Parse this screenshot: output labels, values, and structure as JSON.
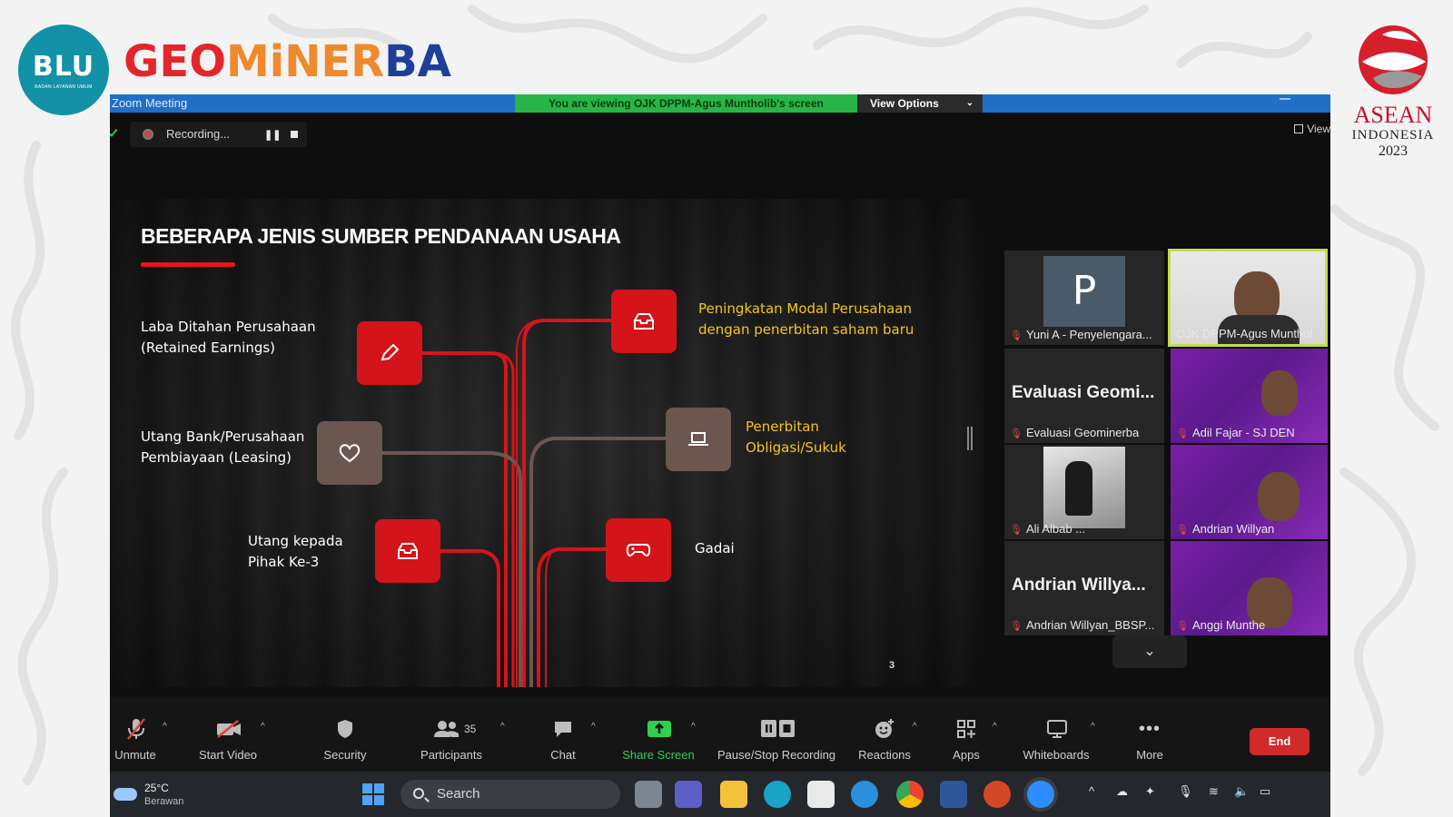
{
  "branding": {
    "blu_logo_text": "BLU",
    "blu_logo_sub": "BADAN LAYANAN UMUM",
    "title_part1": "GEO",
    "title_part2": "MiNER",
    "title_part3": "BA",
    "asean_line1": "ASEAN",
    "asean_line2": "INDONESIA",
    "asean_line3": "2023"
  },
  "zoom": {
    "window_title": "Zoom Meeting",
    "share_banner": "You are viewing OJK DPPM-Agus Muntholib's screen",
    "view_options": "View Options",
    "recording_label": "Recording...",
    "view_label": "View"
  },
  "slide": {
    "title": "BEBERAPA JENIS SUMBER PENDANAAN USAHA",
    "items": [
      {
        "line1": "Laba Ditahan Perusahaan",
        "line2": "(Retained Earnings)"
      },
      {
        "line1": "Utang Bank/Perusahaan",
        "line2": "Pembiayaan (Leasing)"
      },
      {
        "line1": "Utang kepada",
        "line2": "Pihak Ke-3"
      },
      {
        "line1": "Peningkatan Modal Perusahaan",
        "line2": "dengan penerbitan saham baru"
      },
      {
        "line1": "Penerbitan",
        "line2": "Obligasi/Sukuk"
      },
      {
        "line1": "Gadai",
        "line2": ""
      }
    ],
    "page_number": "3",
    "colors": {
      "accent_red": "#d4141a",
      "accent_brown": "#6b5650",
      "highlight_yellow": "#f5c518"
    }
  },
  "gallery": {
    "tiles": [
      {
        "avatar_letter": "P",
        "name": "Yuni A - Penyelengara..."
      },
      {
        "name": "OJK DPPM-Agus Munthol",
        "active": true
      },
      {
        "big_name": "Evaluasi Geomi...",
        "name": "Evaluasi Geominerba"
      },
      {
        "name": "Adil Fajar - SJ DEN"
      },
      {
        "name": "Ali Albab ..."
      },
      {
        "name": "Andrian Willyan"
      },
      {
        "big_name": "Andrian Willya...",
        "name": "Andrian Willyan_BBSP..."
      },
      {
        "name": "Anggi Munthe"
      }
    ]
  },
  "toolbar": {
    "unmute": "Unmute",
    "start_video": "Start Video",
    "security": "Security",
    "participants": "Participants",
    "participants_count": "35",
    "chat": "Chat",
    "share_screen": "Share Screen",
    "pause_stop_recording": "Pause/Stop Recording",
    "reactions": "Reactions",
    "apps": "Apps",
    "whiteboards": "Whiteboards",
    "more": "More",
    "end": "End"
  },
  "taskbar": {
    "temperature": "25°C",
    "weather_desc": "Berawan",
    "search_label": "Search"
  }
}
